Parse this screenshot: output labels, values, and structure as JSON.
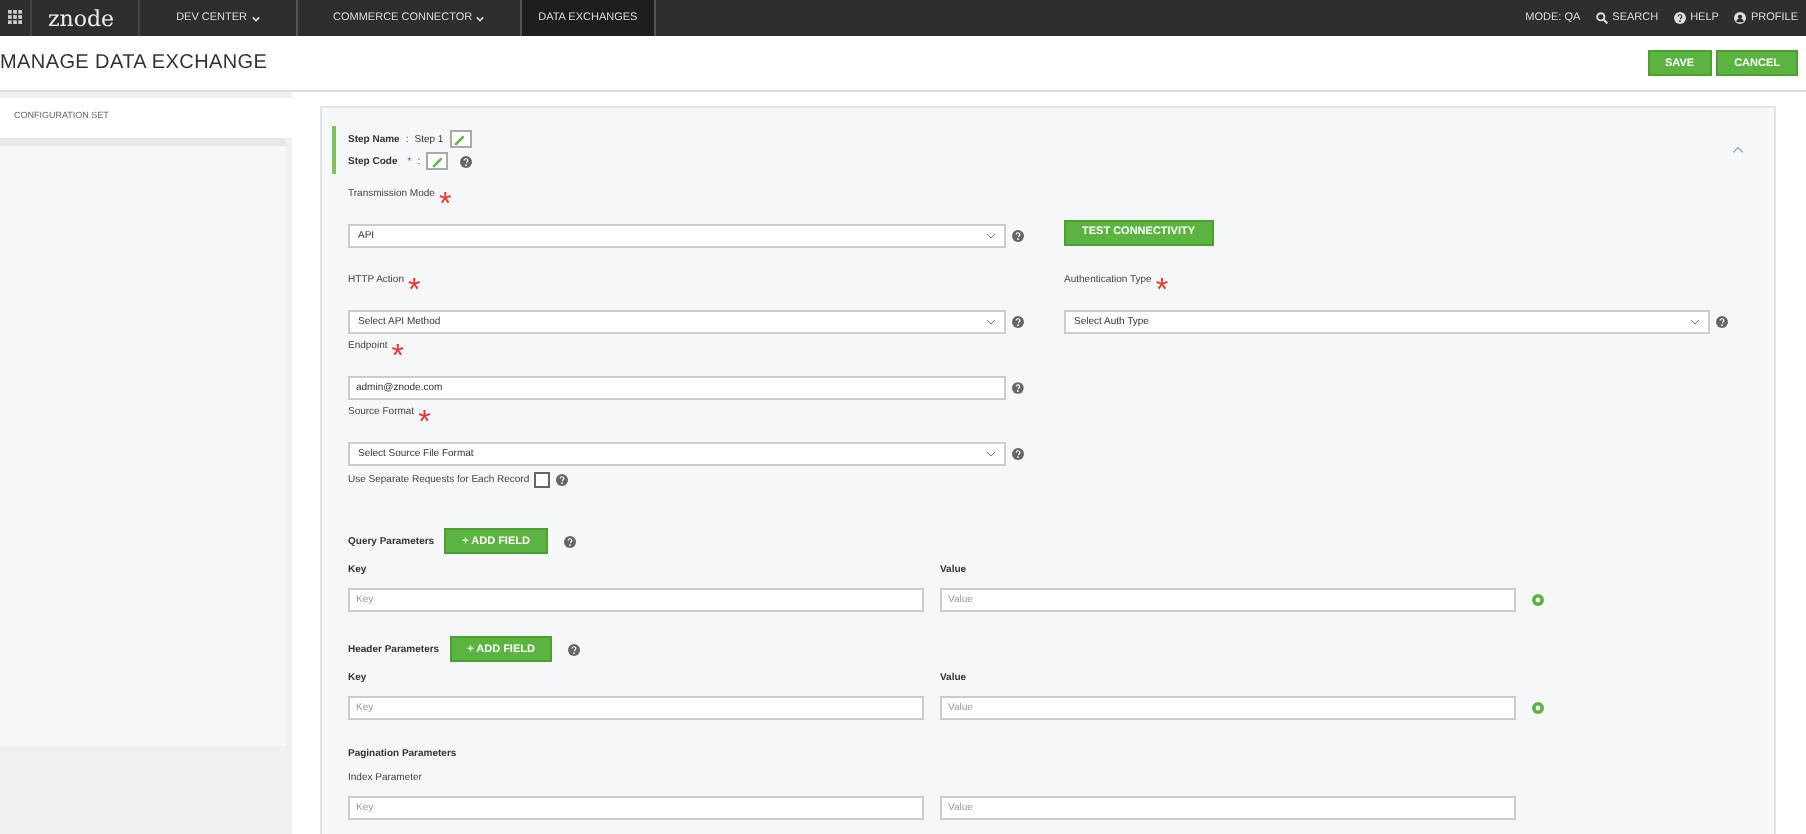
{
  "topbar": {
    "logo": "znode",
    "nav": [
      {
        "label": "DEV CENTER",
        "dropdown": true,
        "selected": false
      },
      {
        "label": "COMMERCE CONNECTOR",
        "dropdown": true,
        "selected": false
      },
      {
        "label": "DATA EXCHANGES",
        "dropdown": false,
        "selected": true
      }
    ],
    "right": [
      {
        "kind": "text",
        "label": "MODE: QA"
      },
      {
        "kind": "search",
        "label": "SEARCH"
      },
      {
        "kind": "help",
        "label": "HELP"
      },
      {
        "kind": "profile",
        "label": "PROFILE"
      }
    ]
  },
  "page_title": "MANAGE DATA EXCHANGE",
  "actions": [
    "SAVE",
    "CANCEL"
  ],
  "sidebar": {
    "items": [
      {
        "label": "CONFIGURATION SET",
        "selected": true
      }
    ]
  },
  "step": {
    "name_label": "Step Name",
    "name_separator": ":",
    "name_value": "Step 1",
    "code_label": "Step Code",
    "code_required_mark": "*",
    "code_separator": ":",
    "expanded": true
  },
  "form": {
    "transmission_mode": {
      "label": "Transmission Mode",
      "required_mark": "*",
      "value": "API"
    },
    "test_button": "TEST CONNECTIVITY",
    "http_action": {
      "label": "HTTP Action",
      "required_mark": "*",
      "value": "Select API Method"
    },
    "auth_type": {
      "label": "Authentication Type",
      "required_mark": "*",
      "value": "Select Auth Type"
    },
    "endpoint": {
      "label": "Endpoint",
      "required_mark": "*",
      "value": "admin@znode.com"
    },
    "source_format": {
      "label": "Source Format",
      "required_mark": "*",
      "value": "Select Source File Format"
    },
    "separate_requests": {
      "label": "Use Separate Requests for Each Record",
      "checked": false
    }
  },
  "parameter_groups": [
    {
      "title": "Query Parameters",
      "add_button": "+ ADD FIELD",
      "key_heading": "Key",
      "value_heading": "Value",
      "key_placeholder": "Key",
      "value_placeholder": "Value",
      "removable": true
    },
    {
      "title": "Header Parameters",
      "add_button": "+ ADD FIELD",
      "key_heading": "Key",
      "value_heading": "Value",
      "key_placeholder": "Key",
      "value_placeholder": "Value",
      "removable": true
    }
  ],
  "pagination": {
    "title": "Pagination Parameters",
    "subtitle": "Index Parameter",
    "key_placeholder": "Key",
    "value_placeholder": "Value"
  }
}
